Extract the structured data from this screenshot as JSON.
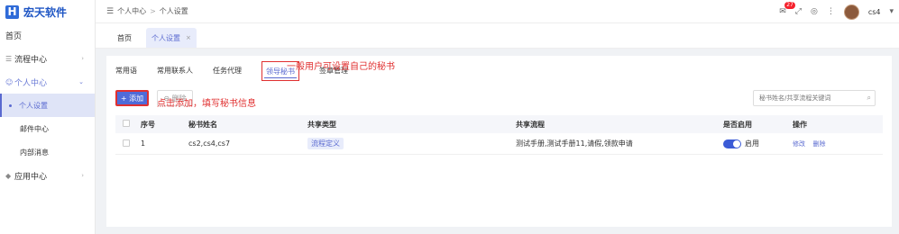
{
  "brand": {
    "logo": "H",
    "name": "宏天软件"
  },
  "sidebar": {
    "items": [
      {
        "label": "首页",
        "icon": ""
      },
      {
        "label": "流程中心",
        "icon": "flow-icon"
      },
      {
        "label": "个人中心",
        "icon": "person-icon"
      },
      {
        "label": "应用中心",
        "icon": "app-icon"
      }
    ],
    "sub_items": [
      "个人设置",
      "邮件中心",
      "内部消息"
    ]
  },
  "header": {
    "breadcrumb": [
      "个人中心",
      "个人设置"
    ],
    "breadcrumb_sep": ">",
    "badge": "27",
    "user": "cs4"
  },
  "tabs": [
    {
      "label": "首页"
    },
    {
      "label": "个人设置",
      "close": "×"
    }
  ],
  "subtabs": [
    "常用语",
    "常用联系人",
    "任务代理",
    "领导秘书",
    "签章管理"
  ],
  "annotations": {
    "top": "一般用户可设置自己的秘书",
    "add": "点击添加，填写秘书信息"
  },
  "toolbar": {
    "add_label": "+ 添加",
    "delete_label": "⊖ 删除",
    "search_placeholder": "秘书姓名/共享流程关键词"
  },
  "table": {
    "columns": [
      "序号",
      "秘书姓名",
      "共享类型",
      "共享流程",
      "是否启用",
      "操作"
    ],
    "rows": [
      {
        "index": "1",
        "names": "cs2,cs4,cs7",
        "share_type": "流程定义",
        "flows": "测试手册,测试手册11,请假,领款申请",
        "enabled": true,
        "enabled_label": "启用",
        "actions": [
          "修改",
          "删除"
        ]
      }
    ]
  },
  "colors": {
    "accent": "#5a6ad0",
    "primary_button": "#4f6bd8",
    "annotation": "#e03030"
  }
}
